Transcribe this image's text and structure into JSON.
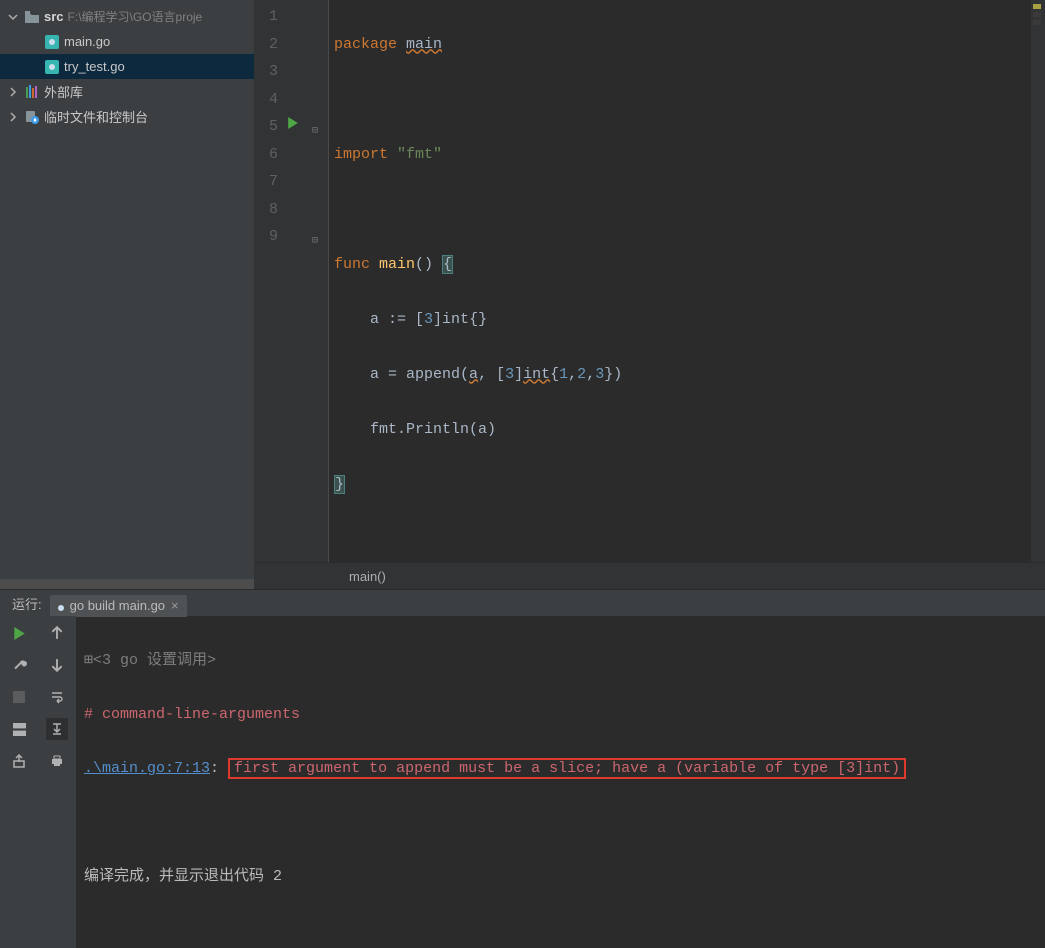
{
  "sidebar": {
    "src": {
      "label": "src",
      "path": "F:\\编程学习\\GO语言proje"
    },
    "files": [
      {
        "name": "main.go",
        "selected": false
      },
      {
        "name": "try_test.go",
        "selected": true
      }
    ],
    "external_libs": "外部库",
    "scratches": "临时文件和控制台"
  },
  "editor": {
    "lines": [
      "1",
      "2",
      "3",
      "4",
      "5",
      "6",
      "7",
      "8",
      "9"
    ],
    "code": {
      "l1_kw": "package",
      "l1_name": "main",
      "l3_kw": "import",
      "l3_str": "\"fmt\"",
      "l5_kw": "func",
      "l5_fn": "main",
      "l5_rest": "() ",
      "l5_brace": "{",
      "l6": "    a := [",
      "l6_num": "3",
      "l6_mid": "]",
      "l6_type": "int",
      "l6_end": "{}",
      "l7a": "    a = ",
      "l7_fn": "append",
      "l7b": "(",
      "l7_var": "a",
      "l7c": ", [",
      "l7_num": "3",
      "l7d": "]",
      "l7_type": "int",
      "l7e": "{",
      "l7_n1": "1",
      "l7_comma1": ",",
      "l7_n2": "2",
      "l7_comma2": ",",
      "l7_n3": "3",
      "l7f": "})",
      "l8a": "    fmt.Println(",
      "l8_var": "a",
      "l8b": ")",
      "l9": "}"
    },
    "breadcrumb": "main()"
  },
  "run": {
    "header_label": "运行:",
    "tab_label": "go build main.go",
    "prompt": "<3 go 设置调用>",
    "err_heading": "# command-line-arguments",
    "err_link": ".\\main.go:7:13",
    "err_colon": ": ",
    "err_msg": "first argument to append must be a slice; have a (variable of type [3]int)",
    "finish_text": "编译完成，并显示退出代码 ",
    "finish_code": "2"
  }
}
